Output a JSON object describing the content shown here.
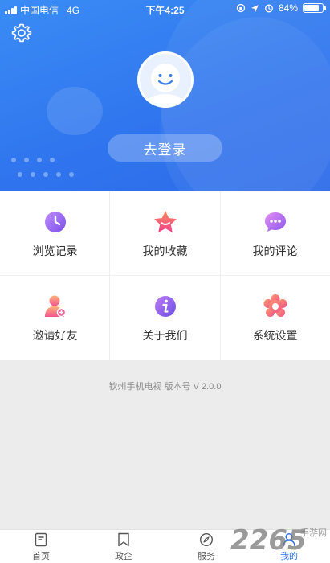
{
  "status_bar": {
    "carrier": "中国电信",
    "network": "4G",
    "time": "下午4:25",
    "battery": "84%",
    "battery_level": 0.84
  },
  "header": {
    "settings_icon": "gear-icon",
    "avatar_icon": "smiley-avatar",
    "login_label": "去登录"
  },
  "menu": {
    "items": [
      {
        "label": "浏览记录",
        "icon": "clock-icon",
        "color": "#8a5cf6"
      },
      {
        "label": "我的收藏",
        "icon": "star-icon",
        "color": "#f5578a"
      },
      {
        "label": "我的评论",
        "icon": "chat-bubble-icon",
        "color": "#a06cf5"
      },
      {
        "label": "邀请好友",
        "icon": "add-user-icon",
        "color": "#f26d8e"
      },
      {
        "label": "关于我们",
        "icon": "info-icon",
        "color": "#7b57f0"
      },
      {
        "label": "系统设置",
        "icon": "flower-gear-icon",
        "color": "#f5627e"
      }
    ]
  },
  "version_text": "钦州手机电视 版本号 V 2.0.0",
  "tabbar": {
    "tabs": [
      {
        "label": "首页",
        "icon": "document-icon"
      },
      {
        "label": "政企",
        "icon": "bookmark-icon"
      },
      {
        "label": "服务",
        "icon": "compass-icon"
      },
      {
        "label": "我的",
        "icon": "person-icon",
        "active": true
      }
    ]
  },
  "watermark": {
    "main": "2265",
    "sub": "手游网"
  },
  "colors": {
    "accent": "#2f74ee",
    "header_bg": "#3a8cf5"
  }
}
